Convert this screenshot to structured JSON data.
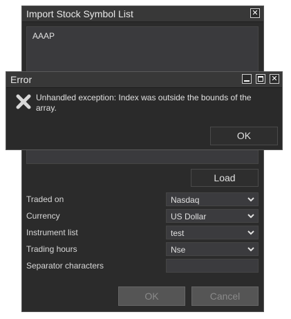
{
  "main_window": {
    "title": "Import Stock Symbol List",
    "close_icon": "close-icon",
    "symbols_text": "AAAP",
    "load_label": "Load",
    "fields": [
      {
        "label": "Traded on",
        "value": "Nasdaq",
        "type": "select"
      },
      {
        "label": "Currency",
        "value": "US Dollar",
        "type": "select"
      },
      {
        "label": "Instrument list",
        "value": "test",
        "type": "select"
      },
      {
        "label": "Trading hours",
        "value": "Nse",
        "type": "select"
      },
      {
        "label": "Separator characters",
        "value": "",
        "type": "text"
      }
    ],
    "ok_label": "OK",
    "cancel_label": "Cancel"
  },
  "error_dialog": {
    "title": "Error",
    "icon": "error-x-icon",
    "message": "Unhandled exception: Index was outside the bounds of the array.",
    "ok_label": "OK"
  },
  "colors": {
    "window_bg": "#2b2b2b",
    "titlebar_bg": "#383838",
    "input_bg": "#3b3b3e",
    "text": "#e0e0e0",
    "disabled_button": "#555555"
  }
}
